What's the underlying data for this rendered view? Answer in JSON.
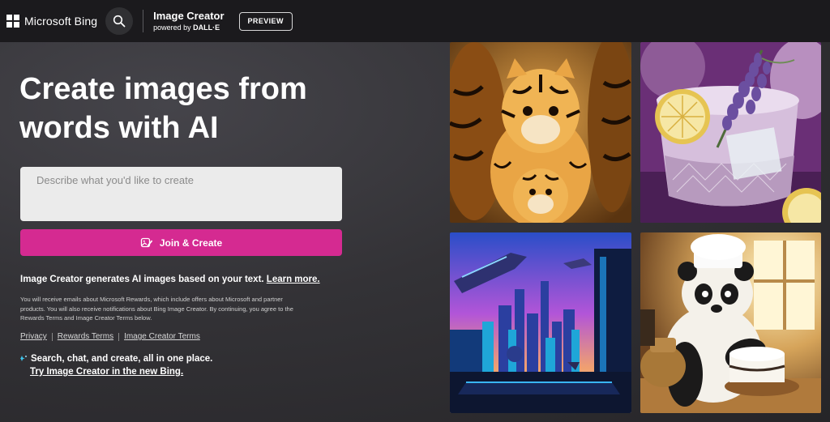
{
  "header": {
    "logo_text": "Microsoft Bing",
    "product_title": "Image Creator",
    "product_sub_prefix": "powered by ",
    "product_sub_brand": "DALL·E",
    "preview_badge": "PREVIEW"
  },
  "hero": {
    "headline_line1": "Create images from",
    "headline_line2": "words with AI",
    "prompt_placeholder": "Describe what you'd like to create",
    "join_button": "Join & Create",
    "info_text": "Image Creator generates AI images based on your text. ",
    "info_link": "Learn more.",
    "fine_print": "You will receive emails about Microsoft Rewards, which include offers about Microsoft and partner products. You will also receive notifications about Bing Image Creator. By continuing, you agree to the Rewards Terms and Image Creator Terms below.",
    "links": [
      "Privacy",
      "Rewards Terms",
      "Image Creator Terms"
    ],
    "promo_text": "Search, chat, and create, all in one place.",
    "promo_link": "Try Image Creator in the new Bing."
  },
  "gallery": [
    {
      "name": "tigers-image",
      "icon": "tiger-nesting-dolls"
    },
    {
      "name": "cocktail-image",
      "icon": "lavender-cocktail"
    },
    {
      "name": "city-image",
      "icon": "futuristic-city"
    },
    {
      "name": "panda-image",
      "icon": "panda-chef"
    }
  ],
  "colors": {
    "accent": "#d52a91",
    "header_bg": "#1b1a1d",
    "body_bg": "#2b2a2e"
  }
}
